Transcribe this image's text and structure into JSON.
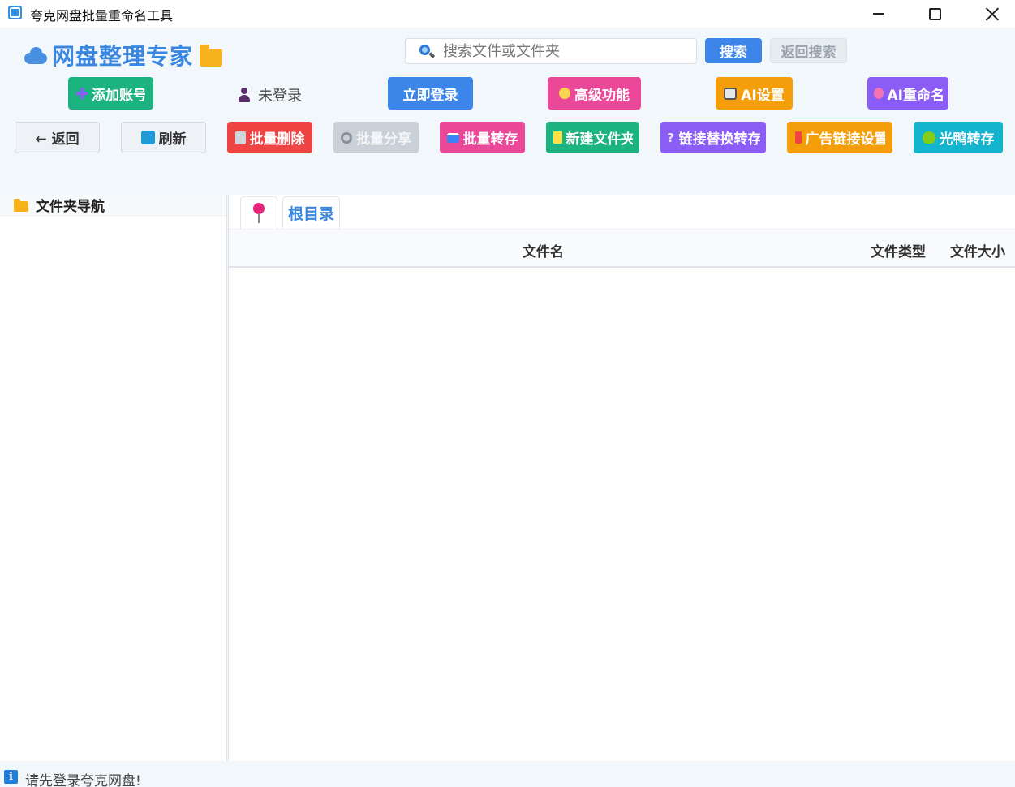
{
  "window": {
    "title": "夸克网盘批量重命名工具"
  },
  "brand": {
    "name": "网盘整理专家"
  },
  "search": {
    "placeholder": "搜索文件或文件夹",
    "button": "搜索",
    "back_button": "返回搜索"
  },
  "account": {
    "add_button": "添加账号",
    "status": "未登录",
    "login_button": "立即登录",
    "advanced_button": "高级功能",
    "ai_settings_button": "AI设置",
    "ai_rename_button": "AI重命名"
  },
  "toolbar": {
    "back": "← 返回",
    "refresh": "刷新",
    "batch_delete": "批量删除",
    "batch_share": "批量分享",
    "batch_transfer": "批量转存",
    "new_folder": "新建文件夹",
    "link_replace": "链接替换转存",
    "ad_link": "广告链接设置",
    "duck_transfer": "光鸭转存"
  },
  "colors": {
    "green": "#1db380",
    "blue": "#3b86e8",
    "pink": "#ec4899",
    "orange": "#f59e0b",
    "purple": "#8b5cf6",
    "red": "#ef4444",
    "gray": "#c9d0d8",
    "teal": "#14b4cf"
  },
  "folder_nav": {
    "title": "文件夹导航"
  },
  "breadcrumb": {
    "root": "根目录"
  },
  "table": {
    "columns": [
      "文件名",
      "文件类型",
      "文件大小"
    ]
  },
  "status": {
    "message": "请先登录夸克网盘!"
  }
}
